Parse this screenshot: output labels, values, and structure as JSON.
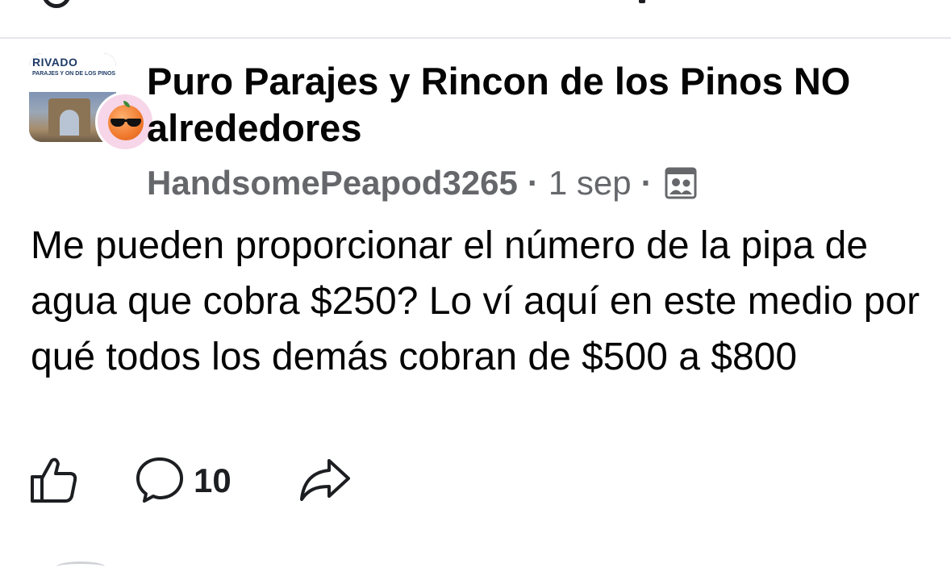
{
  "group": {
    "name": "Puro Parajes y Rincon de los Pinos NO alrededores",
    "avatar_banner_title": "RIVADO",
    "avatar_banner_sub": "PARAJES Y ON DE LOS PINOS"
  },
  "post": {
    "author": "HandsomePeapod3265",
    "separator": "·",
    "date": "1 sep",
    "audience_icon": "group-members-icon",
    "body": "Me pueden proporcionar el número de la pipa de agua que cobra $250? Lo ví aquí en este medio por qué todos los demás cobran de $500 a $800"
  },
  "actions": {
    "like_icon": "thumbs-up-icon",
    "comment_icon": "comment-bubble-icon",
    "comment_count": "10",
    "share_icon": "share-arrow-icon"
  },
  "colors": {
    "text": "#050505",
    "meta": "#65676b",
    "divider": "#e4e6eb"
  }
}
